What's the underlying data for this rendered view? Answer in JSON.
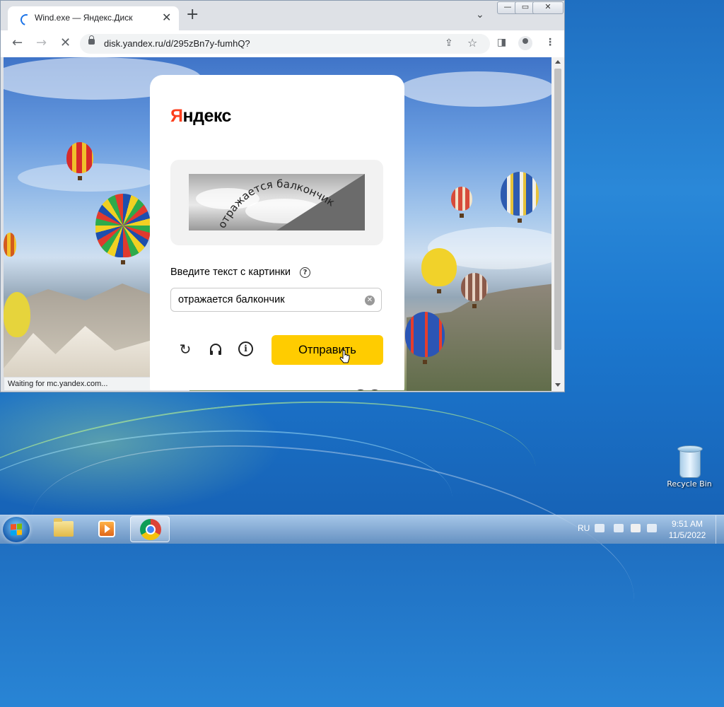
{
  "browser": {
    "tab_title": "Wind.exe — Яндекс.Диск",
    "url": "disk.yandex.ru/d/295zBn7y-fumhQ?",
    "status": "Waiting for mc.yandex.com..."
  },
  "captcha": {
    "logo_first": "Я",
    "logo_rest": "ндекс",
    "image_text": "отражается балкончик",
    "prompt": "Введите текст с картинки",
    "input_value": "отражается балкончик",
    "submit_label": "Отправить"
  },
  "desktop": {
    "recycle_bin_label": "Recycle Bin"
  },
  "taskbar": {
    "language": "RU",
    "time": "9:51 AM",
    "date": "11/5/2022"
  },
  "icons": [
    "spinner-icon",
    "close-icon",
    "new-tab-icon",
    "tab-search-icon",
    "back-icon",
    "forward-icon",
    "stop-icon",
    "lock-icon",
    "share-icon",
    "star-icon",
    "side-panel-icon",
    "profile-icon",
    "menu-icon",
    "help-icon",
    "clear-icon",
    "refresh-icon",
    "headphones-icon",
    "info-icon",
    "windows-start-icon",
    "explorer-icon",
    "media-player-icon",
    "chrome-icon",
    "recycle-bin-icon"
  ],
  "colors": {
    "yandex_red": "#fc3f1d",
    "submit_yellow": "#ffcc00"
  }
}
